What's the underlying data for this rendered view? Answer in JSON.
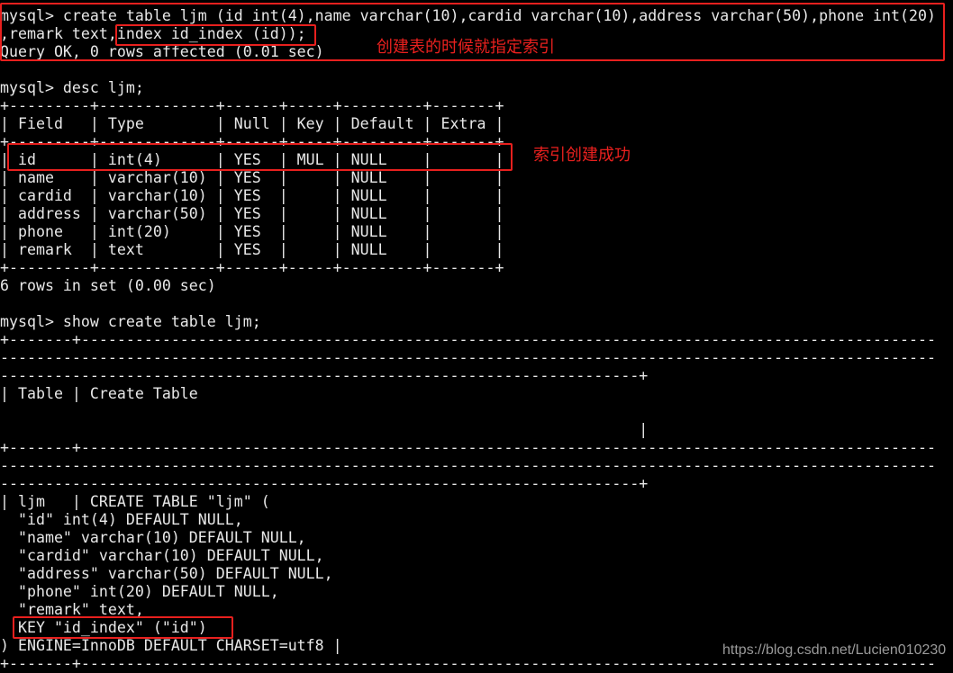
{
  "terminal": {
    "lines": [
      "mysql> create table ljm (id int(4),name varchar(10),cardid varchar(10),address varchar(50),phone int(20)",
      ",remark text,index id_index (id));",
      "Query OK, 0 rows affected (0.01 sec)",
      "",
      "mysql> desc ljm;",
      "+---------+-------------+------+-----+---------+-------+",
      "| Field   | Type        | Null | Key | Default | Extra |",
      "+---------+-------------+------+-----+---------+-------+",
      "| id      | int(4)      | YES  | MUL | NULL    |       |",
      "| name    | varchar(10) | YES  |     | NULL    |       |",
      "| cardid  | varchar(10) | YES  |     | NULL    |       |",
      "| address | varchar(50) | YES  |     | NULL    |       |",
      "| phone   | int(20)     | YES  |     | NULL    |       |",
      "| remark  | text        | YES  |     | NULL    |       |",
      "+---------+-------------+------+-----+---------+-------+",
      "6 rows in set (0.00 sec)",
      "",
      "mysql> show create table ljm;",
      "+-------+-----------------------------------------------------------------------------------------------",
      "--------------------------------------------------------------------------------------------------------",
      "-----------------------------------------------------------------------+",
      "| Table | Create Table",
      "",
      "                                                                       |",
      "+-------+-----------------------------------------------------------------------------------------------",
      "--------------------------------------------------------------------------------------------------------",
      "-----------------------------------------------------------------------+",
      "| ljm   | CREATE TABLE \"ljm\" (",
      "  \"id\" int(4) DEFAULT NULL,",
      "  \"name\" varchar(10) DEFAULT NULL,",
      "  \"cardid\" varchar(10) DEFAULT NULL,",
      "  \"address\" varchar(50) DEFAULT NULL,",
      "  \"phone\" int(20) DEFAULT NULL,",
      "  \"remark\" text,",
      "  KEY \"id_index\" (\"id\")",
      ") ENGINE=InnoDB DEFAULT CHARSET=utf8 |",
      "+-------+-----------------------------------------------------------------------------------------------"
    ]
  },
  "annotations": {
    "create_note": "创建表的时候就指定索引",
    "success_note": "索引创建成功"
  },
  "watermark": "https://blog.csdn.net/Lucien010230",
  "colors": {
    "background": "#000000",
    "text": "#e8e8e8",
    "highlight": "#e8201e"
  }
}
